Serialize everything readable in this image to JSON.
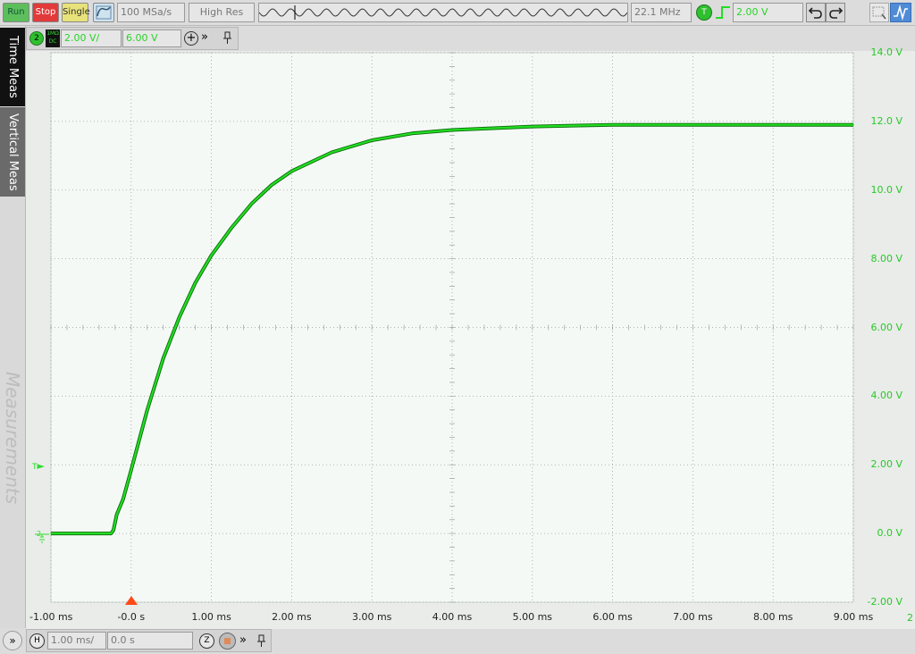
{
  "toolbar": {
    "run_label": "Run",
    "stop_label": "Stop",
    "single_label": "Single",
    "sample_rate": "100 MSa/s",
    "acq_mode": "High Res",
    "frequency": "22.1 MHz",
    "trigger_badge": "T",
    "trigger_level": "2.00 V"
  },
  "channel_bar": {
    "channel_badge": "2",
    "coupling_top": "1MΩ",
    "coupling_bottom": "DC",
    "scale": "2.00 V/",
    "offset": "6.00 V"
  },
  "side_tabs": {
    "time_meas": "Time Meas",
    "vertical_meas": "Vertical Meas",
    "measurements": "Measurements"
  },
  "plot": {
    "y_ticks": [
      "14.0 V",
      "12.0 V",
      "10.0 V",
      "8.00 V",
      "6.00 V",
      "4.00 V",
      "2.00 V",
      "0.0 V",
      "-2.00 V"
    ],
    "x_ticks": [
      "-1.00 ms",
      "-0.0 s",
      "1.00 ms",
      "2.00 ms",
      "3.00 ms",
      "4.00 ms",
      "5.00 ms",
      "6.00 ms",
      "7.00 ms",
      "8.00 ms",
      "9.00 ms"
    ],
    "trigger_marker": "T",
    "channel_marker": "2",
    "corner_label": "2"
  },
  "chart_data": {
    "type": "line",
    "title": "",
    "xlabel": "",
    "ylabel": "",
    "xlim": [
      -1.0,
      9.0
    ],
    "ylim": [
      -2.0,
      14.0
    ],
    "x_unit": "ms",
    "y_unit": "V",
    "grid": true,
    "series": [
      {
        "color": "#22dd22",
        "x": [
          -1.0,
          -0.5,
          -0.25,
          -0.22,
          -0.18,
          -0.1,
          0.0,
          0.2,
          0.4,
          0.6,
          0.8,
          1.0,
          1.25,
          1.5,
          1.75,
          2.0,
          2.5,
          3.0,
          3.5,
          4.0,
          5.0,
          6.0,
          7.0,
          8.0,
          9.0
        ],
        "y": [
          0.0,
          0.0,
          0.0,
          0.1,
          0.55,
          1.0,
          1.85,
          3.6,
          5.1,
          6.3,
          7.3,
          8.1,
          8.9,
          9.6,
          10.15,
          10.55,
          11.1,
          11.45,
          11.65,
          11.75,
          11.85,
          11.9,
          11.9,
          11.9,
          11.9
        ]
      }
    ]
  },
  "horizontal_bar": {
    "h_badge": "H",
    "timebase": "1.00 ms/",
    "delay": "0.0 s",
    "zoom_badge": "Z"
  }
}
